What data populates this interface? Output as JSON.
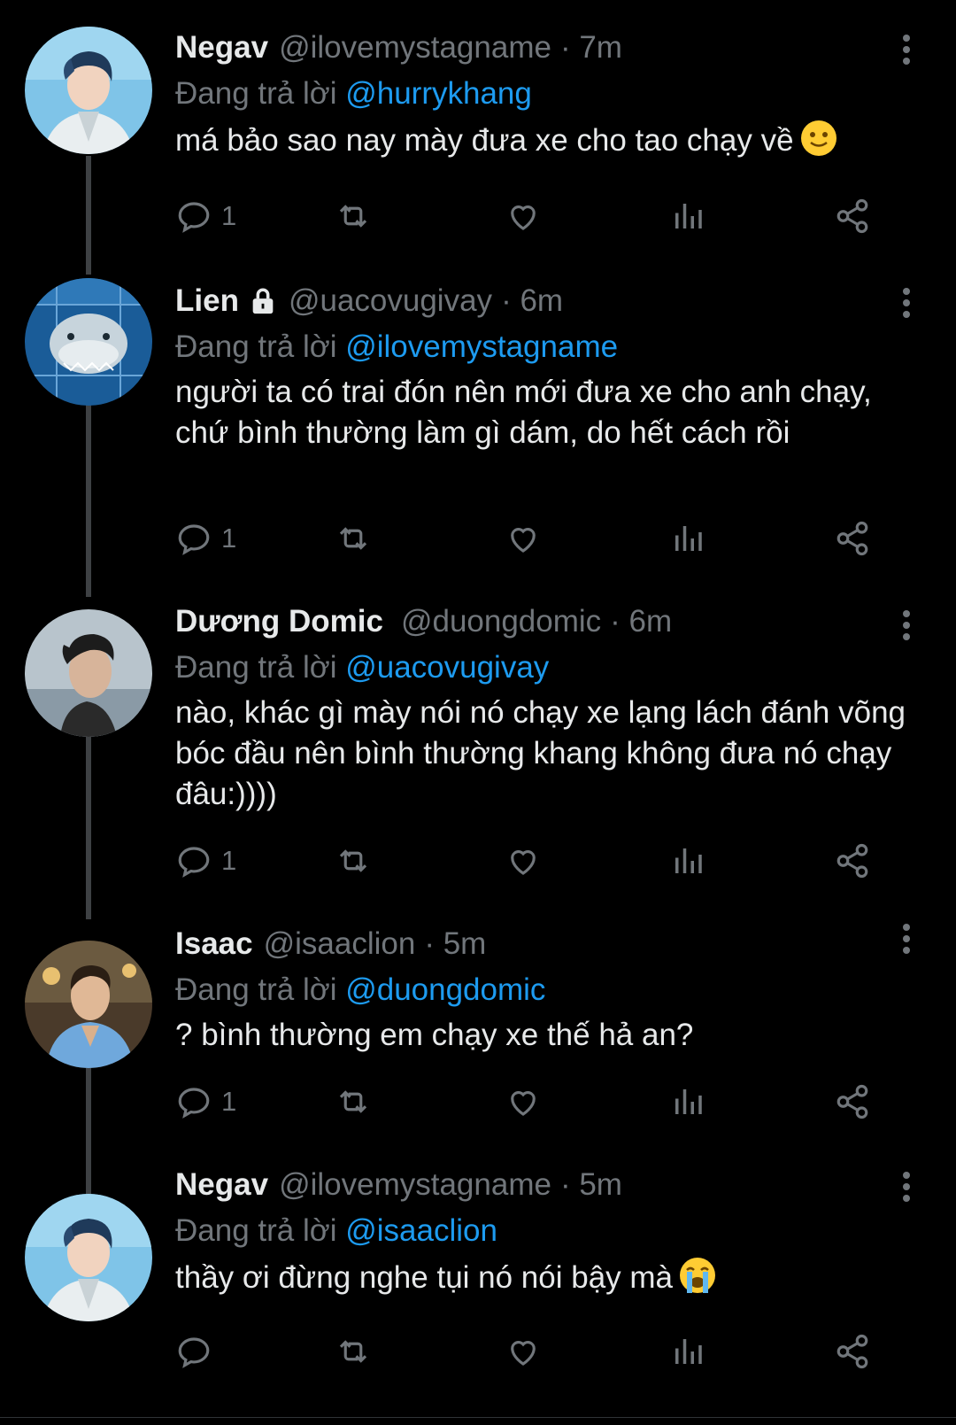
{
  "reply_prefix": "Đang trả lời",
  "colors": {
    "background": "#000000",
    "text": "#e7e9ea",
    "muted": "#71767b",
    "accent": "#1d9bf0",
    "thread_line": "#3e4144"
  },
  "tweets": [
    {
      "name": "Negav",
      "handle": "@ilovemystagname",
      "time": "· 7m",
      "locked": false,
      "reply_to": "@hurrykhang",
      "text": "má bảo sao nay mày đưa xe cho tao chạy về",
      "emoji": "slightly-smiling-face",
      "reply_count": "1",
      "avatar": "boy-white-hoodie"
    },
    {
      "name": "Lien",
      "handle": "@uacovugivay",
      "time": "· 6m",
      "locked": true,
      "reply_to": "@ilovemystagname",
      "text": "người ta có trai đón nên mới đưa xe cho anh chạy, chứ bình thường làm gì dám, do hết cách rồi",
      "emoji": "",
      "reply_count": "1",
      "avatar": "shark-aquarium"
    },
    {
      "name": "Dương Domic",
      "handle": "@duongdomic",
      "time": "· 6m",
      "locked": false,
      "reply_to": "@uacovugivay",
      "text": "nào, khác gì mày nói nó chạy xe lạng lách đánh võng bóc đầu nên bình thường khang không đưa nó chạy đâu:))))",
      "emoji": "",
      "reply_count": "1",
      "avatar": "man-profile"
    },
    {
      "name": "Isaac",
      "handle": "@isaaclion",
      "time": "· 5m",
      "locked": false,
      "reply_to": "@duongdomic",
      "text": "? bình thường em chạy xe thế hả an?",
      "emoji": "",
      "reply_count": "1",
      "avatar": "man-blue-shirt"
    },
    {
      "name": "Negav",
      "handle": "@ilovemystagname",
      "time": "· 5m",
      "locked": false,
      "reply_to": "@isaaclion",
      "text": "thầy ơi đừng nghe tụi nó nói bậy mà",
      "emoji": "loudly-crying-face",
      "reply_count": "",
      "avatar": "boy-white-hoodie"
    }
  ],
  "icons": {
    "reply": "comment-icon",
    "retweet": "retweet-icon",
    "like": "heart-icon",
    "views": "views-icon",
    "share": "share-icon",
    "more": "more-icon",
    "lock": "lock-icon"
  }
}
